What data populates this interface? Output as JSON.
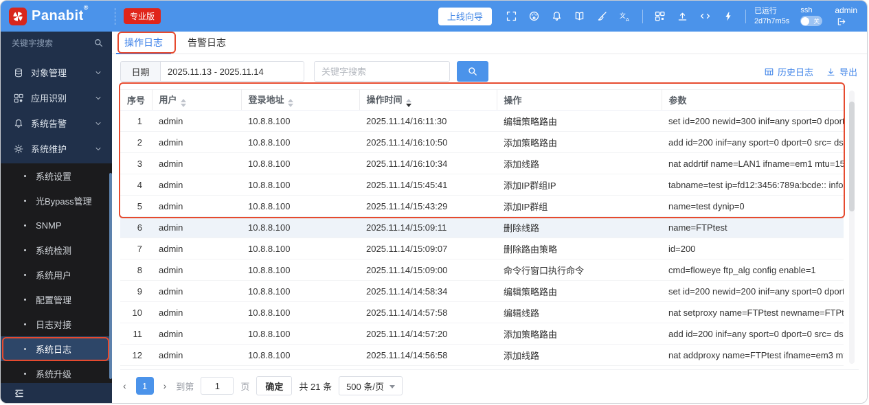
{
  "brand": {
    "name": "Panabit",
    "reg": "®",
    "badge": "专业版"
  },
  "header": {
    "wizard_button": "上线向导",
    "icon_names": [
      "fullscreen-icon",
      "palette-icon",
      "bell-icon",
      "book-icon",
      "broom-icon",
      "translate-icon",
      "modules-grid-icon",
      "upgrade-icon",
      "cli-code-icon",
      "lightning-icon"
    ],
    "uptime_label": "已运行",
    "uptime_value": "2d7h7m5s",
    "ssh_label": "ssh",
    "ssh_toggle_state": "关",
    "username": "admin"
  },
  "sidebar": {
    "search_placeholder": "关键字搜索",
    "groups": [
      "对象管理",
      "应用识别",
      "系统告警",
      "系统维护"
    ],
    "submenu": [
      "系统设置",
      "光Bypass管理",
      "SNMP",
      "系统检测",
      "系统用户",
      "配置管理",
      "日志对接",
      "系统日志",
      "系统升级"
    ],
    "selected_item": "系统日志"
  },
  "tabs": [
    "操作日志",
    "告警日志"
  ],
  "toolbar": {
    "date_label": "日期",
    "date_value": "2025.11.13 - 2025.11.14",
    "search_placeholder": "关键字搜索",
    "history_link": "历史日志",
    "export_link": "导出"
  },
  "table": {
    "headers": [
      "序号",
      "用户",
      "登录地址",
      "操作时间",
      "操作",
      "参数"
    ],
    "sorted_column": "操作时间",
    "sort_direction": "desc",
    "rows": [
      {
        "no": "1",
        "user": "admin",
        "ip": "10.8.8.100",
        "time": "2025.11.14/16:11:30",
        "action": "编辑策略路由",
        "params": "set id=200 newid=300 inif=any sport=0 dport…"
      },
      {
        "no": "2",
        "user": "admin",
        "ip": "10.8.8.100",
        "time": "2025.11.14/16:10:50",
        "action": "添加策略路由",
        "params": "add id=200 inif=any sport=0 dport=0 src= dst…"
      },
      {
        "no": "3",
        "user": "admin",
        "ip": "10.8.8.100",
        "time": "2025.11.14/16:10:34",
        "action": "添加线路",
        "params": "nat addrtif name=LAN1 ifname=em1 mtu=15…"
      },
      {
        "no": "4",
        "user": "admin",
        "ip": "10.8.8.100",
        "time": "2025.11.14/15:45:41",
        "action": "添加IP群组IP",
        "params": "tabname=test ip=fd12:3456:789a:bcde:: info="
      },
      {
        "no": "5",
        "user": "admin",
        "ip": "10.8.8.100",
        "time": "2025.11.14/15:43:29",
        "action": "添加IP群组",
        "params": "name=test dynip=0"
      },
      {
        "no": "6",
        "user": "admin",
        "ip": "10.8.8.100",
        "time": "2025.11.14/15:09:11",
        "action": "删除线路",
        "params": "name=FTPtest",
        "highlighted": true
      },
      {
        "no": "7",
        "user": "admin",
        "ip": "10.8.8.100",
        "time": "2025.11.14/15:09:07",
        "action": "删除路由策略",
        "params": "id=200"
      },
      {
        "no": "8",
        "user": "admin",
        "ip": "10.8.8.100",
        "time": "2025.11.14/15:09:00",
        "action": "命令行窗口执行命令",
        "params": "cmd=floweye ftp_alg config enable=1"
      },
      {
        "no": "9",
        "user": "admin",
        "ip": "10.8.8.100",
        "time": "2025.11.14/14:58:34",
        "action": "编辑策略路由",
        "params": "set id=200 newid=200 inif=any sport=0 dport…"
      },
      {
        "no": "10",
        "user": "admin",
        "ip": "10.8.8.100",
        "time": "2025.11.14/14:57:58",
        "action": "编辑线路",
        "params": "nat setproxy name=FTPtest newname=FTPt…"
      },
      {
        "no": "11",
        "user": "admin",
        "ip": "10.8.8.100",
        "time": "2025.11.14/14:57:20",
        "action": "添加策略路由",
        "params": "add id=200 inif=any sport=0 dport=0 src= dst…"
      },
      {
        "no": "12",
        "user": "admin",
        "ip": "10.8.8.100",
        "time": "2025.11.14/14:56:58",
        "action": "添加线路",
        "params": "nat addproxy name=FTPtest ifname=em3 mt…"
      }
    ]
  },
  "pagination": {
    "prev": "‹",
    "current_page": "1",
    "next": "›",
    "goto_label": "到第",
    "goto_value": "1",
    "page_unit": "页",
    "confirm": "确定",
    "total": "共 21 条",
    "page_size": "500 条/页"
  },
  "colors": {
    "header_blue": "#4b93ea",
    "badge_red": "#e0251a",
    "annotation_red": "#e64a2e",
    "sidebar_navy": "#20304a",
    "submenu_dark": "#1b1b1d",
    "selected_blue": "#2d4668",
    "link_blue": "#3e83e8"
  }
}
